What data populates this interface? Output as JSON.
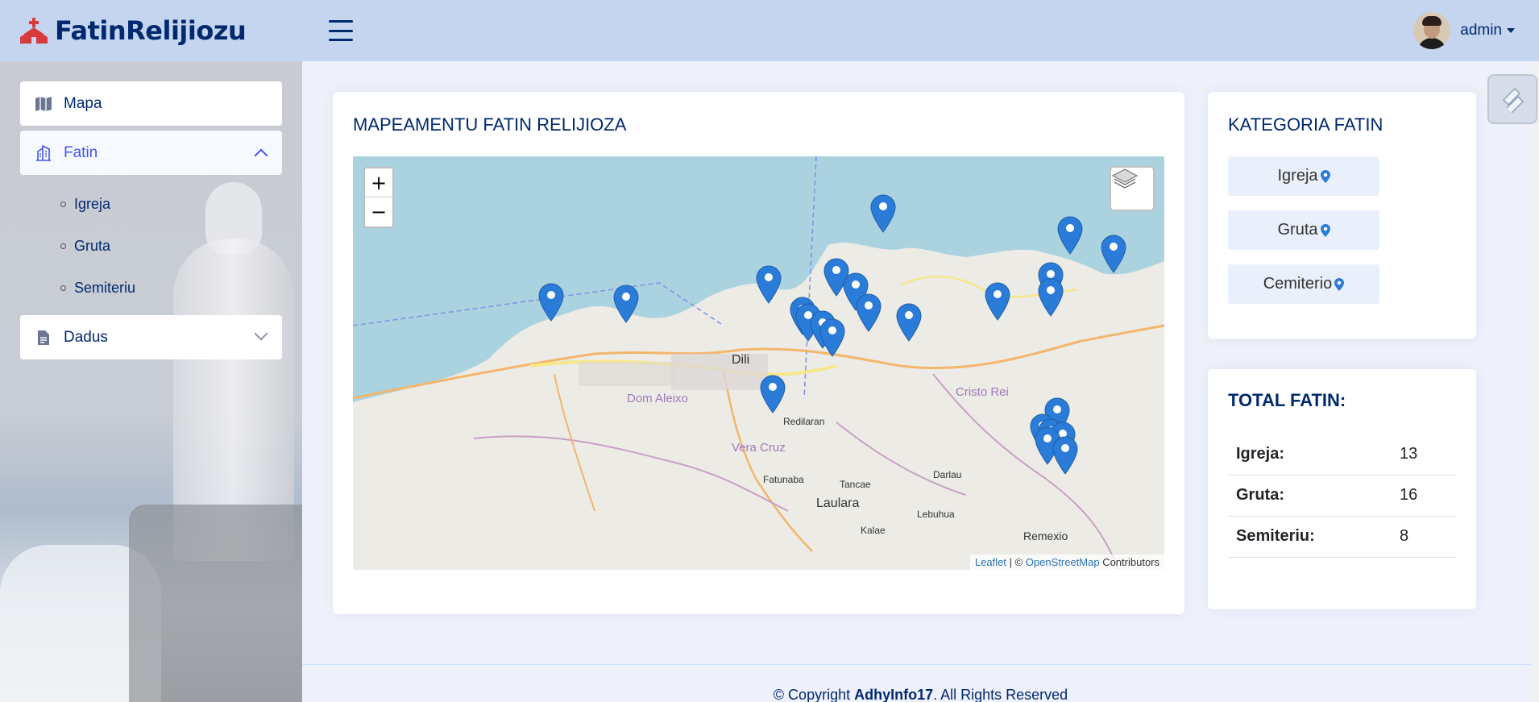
{
  "app": {
    "title": "FatinRelijiozu"
  },
  "header": {
    "user_name": "admin"
  },
  "sidebar": {
    "items": [
      {
        "label": "Mapa"
      },
      {
        "label": "Fatin"
      },
      {
        "label": "Dadus"
      }
    ],
    "fatin_sub": [
      {
        "label": "Igreja"
      },
      {
        "label": "Gruta"
      },
      {
        "label": "Semiteriu"
      }
    ]
  },
  "map_card": {
    "title": "MAPEAMENTU FATIN RELIJIOZA",
    "zoom_in": "+",
    "zoom_out": "−",
    "attribution": {
      "leaflet": "Leaflet",
      "sep": " | © ",
      "osm": "OpenStreetMap",
      "contrib": " Contributors"
    },
    "places": [
      {
        "name": "Dili"
      },
      {
        "name": "Dom Aleixo"
      },
      {
        "name": "Cristo Rei"
      },
      {
        "name": "Vera Cruz"
      },
      {
        "name": "Redilaran"
      },
      {
        "name": "Fatunaba"
      },
      {
        "name": "Tancae"
      },
      {
        "name": "Laulara"
      },
      {
        "name": "Darlau"
      },
      {
        "name": "Lebuhua"
      },
      {
        "name": "Kalae"
      },
      {
        "name": "Remexio"
      }
    ]
  },
  "category_card": {
    "title": "KATEGORIA FATIN",
    "buttons": [
      {
        "label": "Igreja"
      },
      {
        "label": "Gruta"
      },
      {
        "label": "Cemiterio"
      }
    ]
  },
  "total_card": {
    "title": "TOTAL FATIN:",
    "rows": [
      {
        "key": "Igreja:",
        "value": "13"
      },
      {
        "key": "Gruta:",
        "value": "16"
      },
      {
        "key": "Semiteriu:",
        "value": "8"
      }
    ]
  },
  "footer": {
    "prefix": "© Copyright ",
    "owner": "AdhyInfo17",
    "suffix": ". All Rights Reserved"
  },
  "colors": {
    "primary": "#012970",
    "accent": "#4154f1",
    "header_bg": "#c5d5ef",
    "marker": "#2b7bd8",
    "sea": "#aad3df"
  },
  "icons": [
    "church-logo-icon",
    "hamburger-menu-icon",
    "map-icon",
    "building-icon",
    "document-icon",
    "layers-icon",
    "map-marker-icon",
    "theme-switcher-icon"
  ]
}
